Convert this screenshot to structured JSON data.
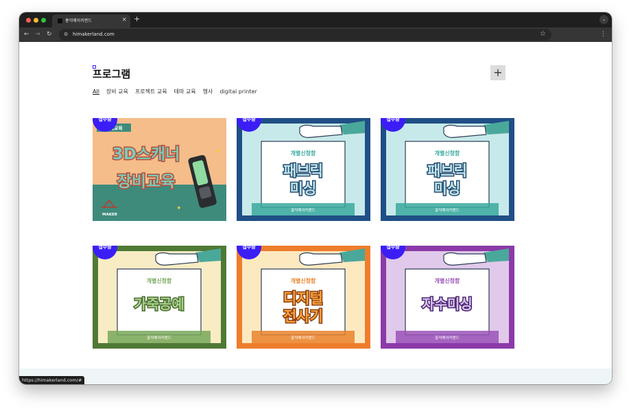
{
  "browser": {
    "tab_title": "홍익메이커랜드",
    "tab_close": "×",
    "new_tab": "+",
    "url": "himakerland.com",
    "status_url": "https://himakerland.com/#"
  },
  "page": {
    "title": "프로그램",
    "add_symbol": "+",
    "filters": [
      {
        "label": "All",
        "active": true
      },
      {
        "label": "장비 교육",
        "active": false
      },
      {
        "label": "프로젝트 교육",
        "active": false
      },
      {
        "label": "테마 교육",
        "active": false
      },
      {
        "label": "행사",
        "active": false
      },
      {
        "label": "digital printer",
        "active": false
      }
    ]
  },
  "programs": [
    {
      "badge": "접수중",
      "tag": "장비교육",
      "line1": "3D스캐너",
      "line2": "장비교육",
      "logo": "MAKER"
    },
    {
      "badge": "접수중",
      "kind": "개별신청함",
      "line1": "패브릭",
      "line2": "미싱",
      "footer": "홍익메이커랜드",
      "frame": "#1f4f86",
      "fill": "#c7e9ea",
      "text_color": "#bfe6ea",
      "stroke": "#244a72",
      "kind_color": "#3aa99e"
    },
    {
      "badge": "접수중",
      "kind": "개별신청함",
      "line1": "패브릭",
      "line2": "미싱",
      "footer": "홍익메이커랜드",
      "frame": "#1f4f86",
      "fill": "#c7e9ea",
      "text_color": "#bfe6ea",
      "stroke": "#244a72",
      "kind_color": "#3aa99e"
    },
    {
      "badge": "접수중",
      "kind": "개별신청함",
      "line1": "가죽공예",
      "line2": "",
      "footer": "홍익메이커랜드",
      "frame": "#4f7a35",
      "fill": "#f8ecc4",
      "text_color": "#a9d08e",
      "stroke": "#4a6d2e",
      "kind_color": "#78a85a"
    },
    {
      "badge": "접수중",
      "kind": "개별신청함",
      "line1": "디지털",
      "line2": "전사기",
      "footer": "홍익메이커랜드",
      "frame": "#ee7d2c",
      "fill": "#fde9c0",
      "text_color": "#f7a13a",
      "stroke": "#8a3d12",
      "kind_color": "#e9822d"
    },
    {
      "badge": "접수중",
      "kind": "개별신청함",
      "line1": "자수미싱",
      "line2": "",
      "footer": "홍익메이커랜드",
      "frame": "#8b3aa8",
      "fill": "#e0c9ea",
      "text_color": "#d9c2ee",
      "stroke": "#4a2370",
      "kind_color": "#9a52b8"
    }
  ]
}
